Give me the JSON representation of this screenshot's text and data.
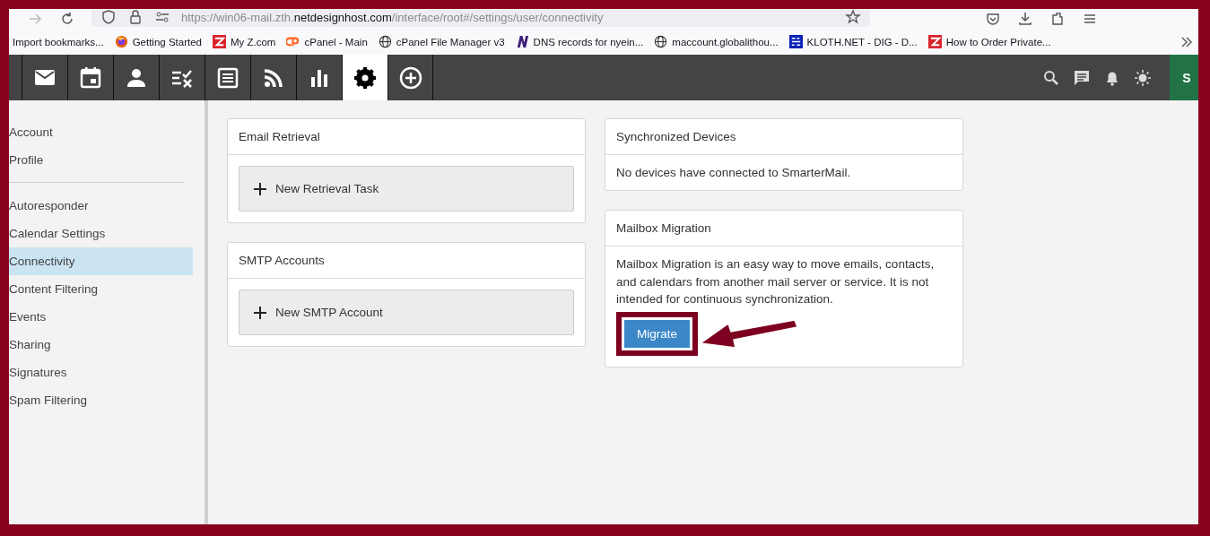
{
  "browser": {
    "url_prefix": "https://win06-mail.zth.",
    "url_domain": "netdesignhost.com",
    "url_suffix": "/interface/root#/settings/user/connectivity"
  },
  "bookmarks": [
    {
      "kind": "plain",
      "label": "Import bookmarks..."
    },
    {
      "kind": "firefox",
      "label": "Getting Started"
    },
    {
      "kind": "z",
      "label": "My Z.com"
    },
    {
      "kind": "cpanel",
      "label": "cPanel - Main"
    },
    {
      "kind": "globe",
      "label": "cPanel File Manager v3"
    },
    {
      "kind": "n",
      "label": "DNS records for nyein..."
    },
    {
      "kind": "globe",
      "label": "maccount.globalithou..."
    },
    {
      "kind": "dl",
      "label": "KLOTH.NET - DIG - D..."
    },
    {
      "kind": "z",
      "label": "How to Order Private..."
    }
  ],
  "app_tabs": [
    {
      "kind": "mail",
      "selected": false
    },
    {
      "kind": "calendar",
      "selected": false
    },
    {
      "kind": "contacts",
      "selected": false
    },
    {
      "kind": "tasks",
      "selected": false
    },
    {
      "kind": "notes",
      "selected": false
    },
    {
      "kind": "rss",
      "selected": false
    },
    {
      "kind": "reports",
      "selected": false
    },
    {
      "kind": "settings",
      "selected": true
    },
    {
      "kind": "add",
      "selected": false
    }
  ],
  "user": {
    "initial": "S"
  },
  "sidebar": {
    "groups": [
      [
        {
          "label": "Account",
          "selected": false
        },
        {
          "label": "Profile",
          "selected": false
        }
      ],
      [
        {
          "label": "Autoresponder",
          "selected": false
        },
        {
          "label": "Calendar Settings",
          "selected": false
        },
        {
          "label": "Connectivity",
          "selected": true
        },
        {
          "label": "Content Filtering",
          "selected": false
        },
        {
          "label": "Events",
          "selected": false
        },
        {
          "label": "Sharing",
          "selected": false
        },
        {
          "label": "Signatures",
          "selected": false
        },
        {
          "label": "Spam Filtering",
          "selected": false
        }
      ]
    ]
  },
  "columns": [
    [
      {
        "title": "Email Retrieval",
        "kind": "add",
        "action": "New Retrieval Task"
      },
      {
        "title": "SMTP Accounts",
        "kind": "add",
        "action": "New SMTP Account"
      }
    ],
    [
      {
        "title": "Synchronized Devices",
        "kind": "text",
        "text": "No devices have connected to SmarterMail."
      },
      {
        "title": "Mailbox Migration",
        "kind": "migrate",
        "text": "Mailbox Migration is an easy way to move emails, contacts, and calendars from another mail server or service. It is not intended for continuous synchronization.",
        "action": "Migrate"
      }
    ]
  ]
}
